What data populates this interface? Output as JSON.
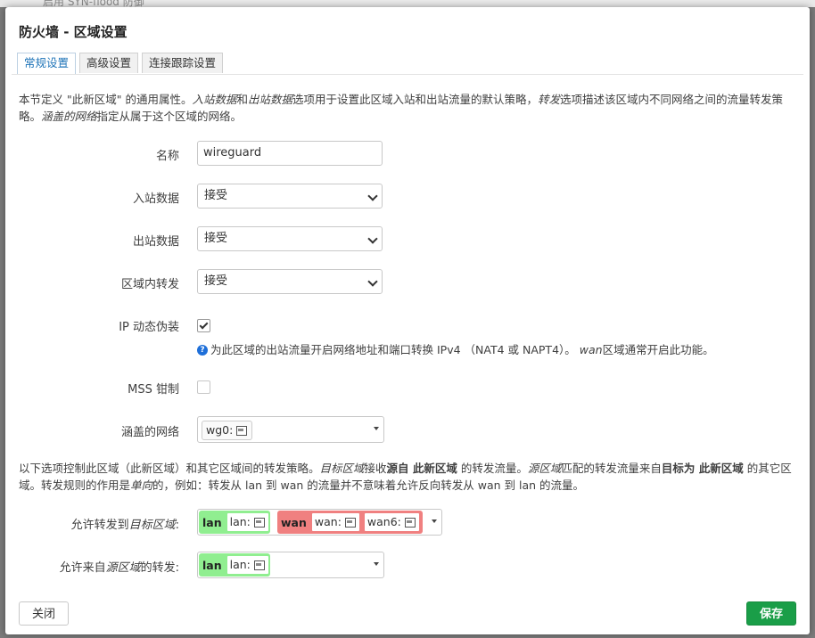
{
  "background": {
    "strip_text": "启用 SYN-flood 防御"
  },
  "modal": {
    "title": "防火墙 - 区域设置",
    "tabs": [
      {
        "label": "常规设置",
        "active": true
      },
      {
        "label": "高级设置",
        "active": false
      },
      {
        "label": "连接跟踪设置",
        "active": false
      }
    ],
    "intro": {
      "p1": "本节定义 \"此新区域\" 的通用属性。",
      "p2_i": "入站数据",
      "p3": "和",
      "p4_i": "出站数据",
      "p5": "选项用于设置此区域入站和出站流量的默认策略，",
      "p6_i": "转发",
      "p7": "选项描述该区域内不同网络之间的流量转发策略。",
      "p8_i": "涵盖的网络",
      "p9": "指定从属于这个区域的网络。"
    },
    "fields": {
      "name": {
        "label": "名称",
        "value": "wireguard"
      },
      "input": {
        "label": "入站数据",
        "value": "接受"
      },
      "output": {
        "label": "出站数据",
        "value": "接受"
      },
      "forward": {
        "label": "区域内转发",
        "value": "接受"
      },
      "masq": {
        "label": "IP 动态伪装",
        "checked": true,
        "help_a": "为此区域的出站流量开启网络地址和端口转换 IPv4 （NAT4 或 NAPT4）。",
        "help_i": "wan",
        "help_b": "区域通常开启此功能。"
      },
      "mss": {
        "label": "MSS 钳制",
        "checked": false
      },
      "networks": {
        "label": "涵盖的网络",
        "tag": "wg0:"
      }
    },
    "forward_intro": {
      "a": "以下选项控制此区域（此新区域）和其它区域间的转发策略。",
      "b_i": "目标区域",
      "c": "接收",
      "d_b": "源自 此新区域",
      "e": " 的转发流量。",
      "f_i": "源区域",
      "g": "匹配的转发流量来自",
      "h_b": "目标为 此新区域",
      "j": " 的其它区域。转发规则的作用是",
      "k_i": "单向",
      "l": "的，例如：转发从 lan 到 wan 的流量并不意味着允许反向转发从 wan 到 lan 的流量。"
    },
    "allow_to": {
      "label_a": "允许转发到",
      "label_i": "目标区域",
      "label_b": ":",
      "zones": [
        {
          "zone": "lan",
          "color": "#90ee90",
          "ifaces": [
            "lan:"
          ]
        },
        {
          "zone": "wan",
          "color": "#f08080",
          "ifaces": [
            "wan:",
            "wan6:"
          ]
        }
      ]
    },
    "allow_from": {
      "label_a": "允许来自",
      "label_i": "源区域",
      "label_b": "的转发:",
      "zones": [
        {
          "zone": "lan",
          "color": "#90ee90",
          "ifaces": [
            "lan:"
          ]
        }
      ]
    },
    "buttons": {
      "close": "关闭",
      "save": "保存"
    }
  },
  "colors": {
    "accent": "#1f74b8",
    "save": "#1a9e48",
    "lan": "#90ee90",
    "wan": "#f08080"
  }
}
